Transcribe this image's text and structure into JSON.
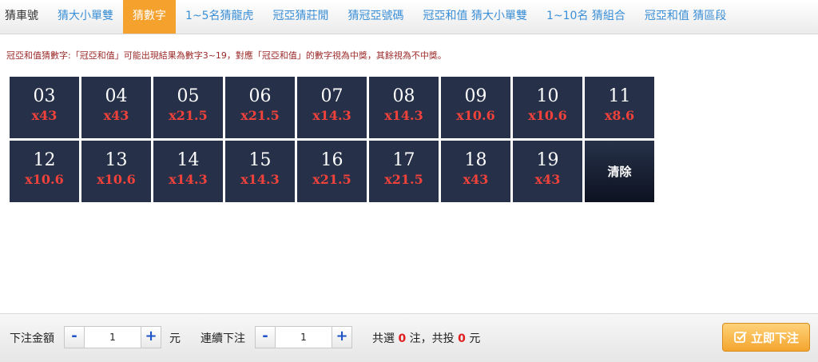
{
  "tabs": [
    {
      "label": "猜車號"
    },
    {
      "label": "猜大小單雙"
    },
    {
      "label": "猜數字"
    },
    {
      "label": "1~5名猜龍虎"
    },
    {
      "label": "冠亞猜莊閒"
    },
    {
      "label": "猜冠亞號碼"
    },
    {
      "label": "冠亞和值 猜大小單雙"
    },
    {
      "label": "1~10名 猜組合"
    },
    {
      "label": "冠亞和值 猜區段"
    }
  ],
  "active_tab": "猜數字",
  "description": "冠亞和值猜數字:「冠亞和值」可能出現結果為數字3~19，對應「冠亞和值」的數字視為中獎，其餘視為不中獎。",
  "cells": [
    {
      "num": "03",
      "odds": "x43"
    },
    {
      "num": "04",
      "odds": "x43"
    },
    {
      "num": "05",
      "odds": "x21.5"
    },
    {
      "num": "06",
      "odds": "x21.5"
    },
    {
      "num": "07",
      "odds": "x14.3"
    },
    {
      "num": "08",
      "odds": "x14.3"
    },
    {
      "num": "09",
      "odds": "x10.6"
    },
    {
      "num": "10",
      "odds": "x10.6"
    },
    {
      "num": "11",
      "odds": "x8.6"
    },
    {
      "num": "12",
      "odds": "x10.6"
    },
    {
      "num": "13",
      "odds": "x10.6"
    },
    {
      "num": "14",
      "odds": "x14.3"
    },
    {
      "num": "15",
      "odds": "x14.3"
    },
    {
      "num": "16",
      "odds": "x21.5"
    },
    {
      "num": "17",
      "odds": "x21.5"
    },
    {
      "num": "18",
      "odds": "x43"
    },
    {
      "num": "19",
      "odds": "x43"
    }
  ],
  "clear_label": "清除",
  "footer": {
    "amount_label": "下注金額",
    "amount_value": "1",
    "unit": "元",
    "continuous_label": "連續下注",
    "continuous_value": "1",
    "minus": "-",
    "plus": "+",
    "summary_prefix": "共選",
    "selected_count": "0",
    "summary_mid": "注，共投",
    "total_amount": "0",
    "summary_suffix": "元",
    "submit_label": "立即下注"
  },
  "colors": {
    "accent": "#f4a12d",
    "cell_bg": "#263149",
    "odds": "#f0413a",
    "tab_text": "#3b8fd6"
  },
  "icons": {
    "submit": "checkbox-icon"
  }
}
